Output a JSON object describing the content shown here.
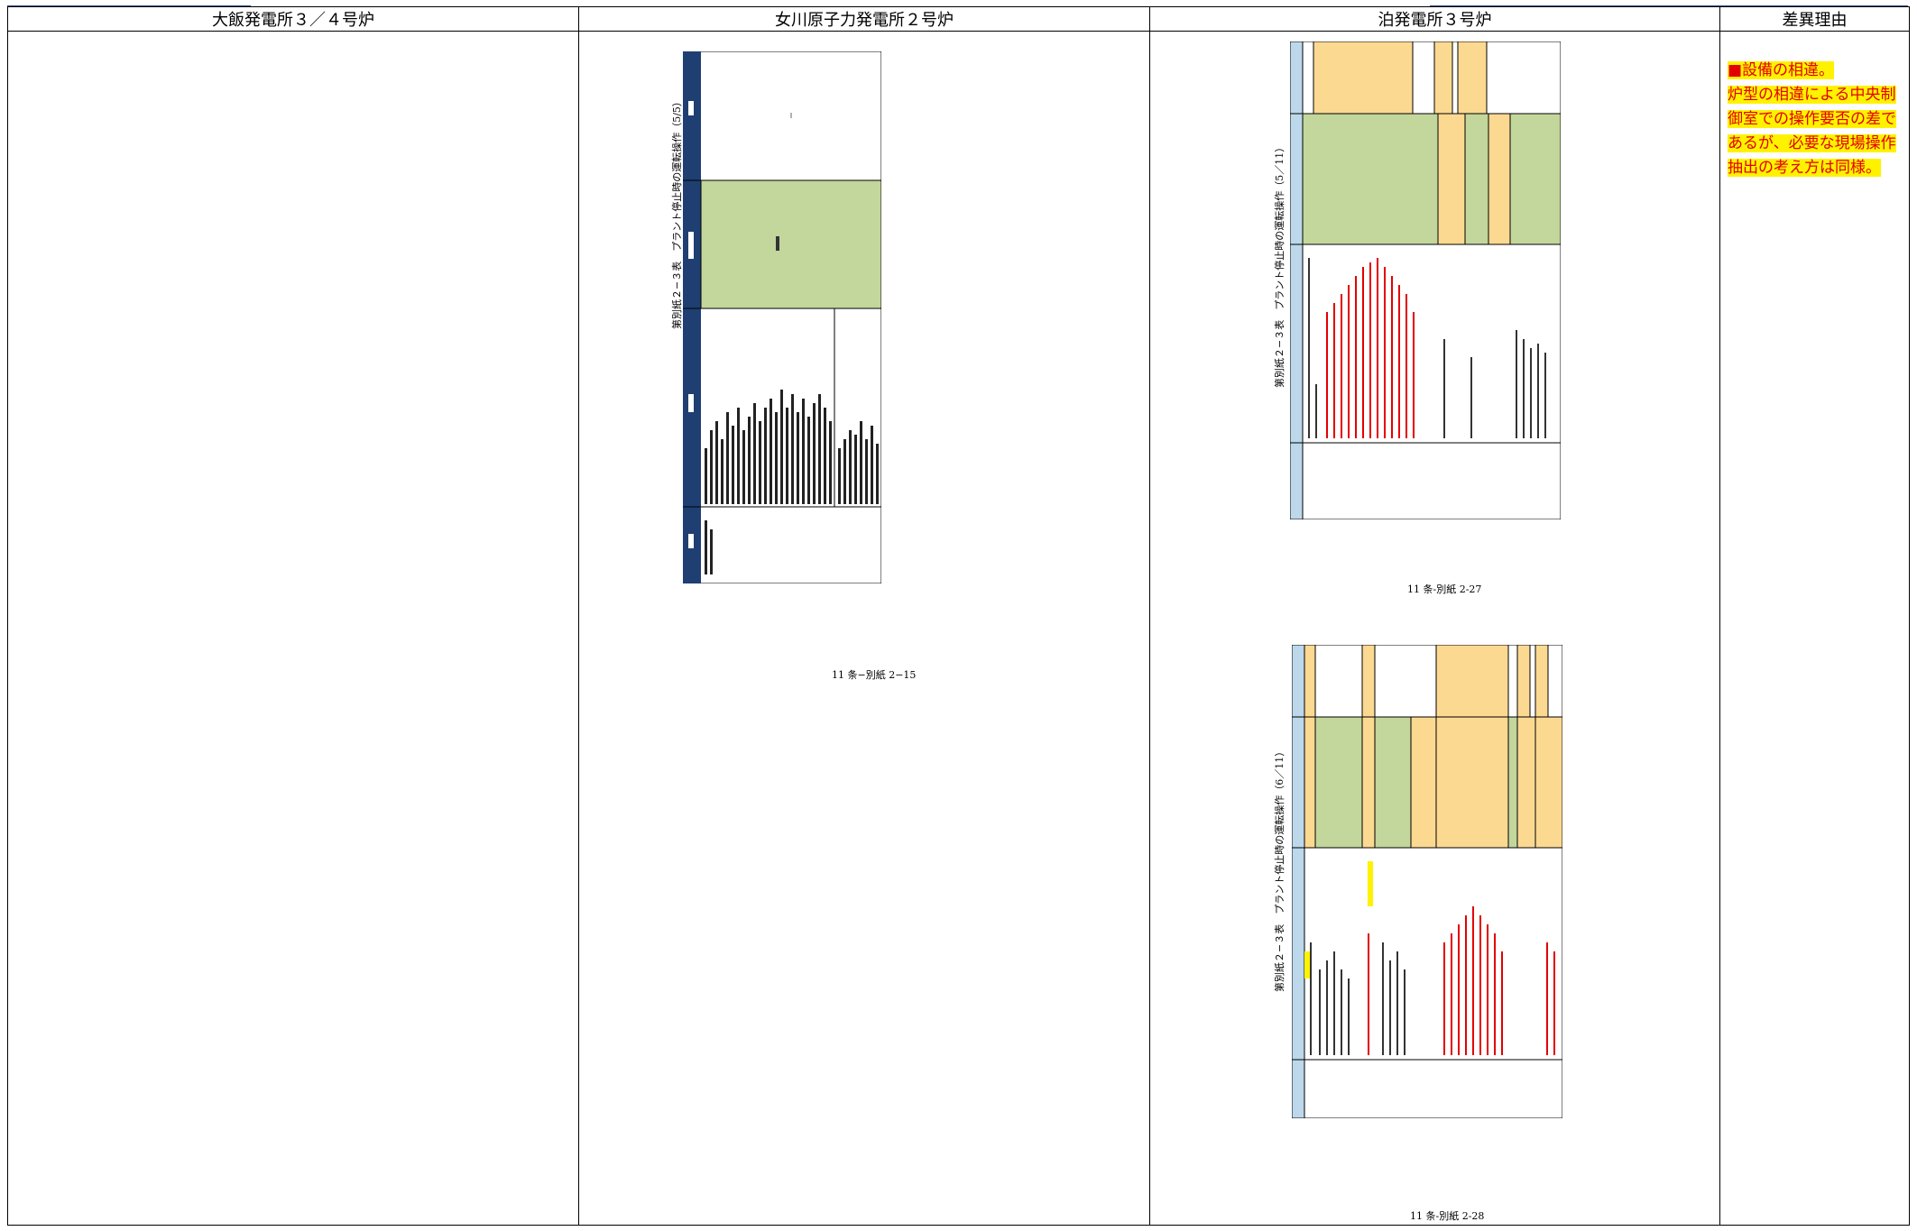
{
  "headers": {
    "col1": "大飯発電所３／４号炉",
    "col2": "女川原子力発電所２号炉",
    "col3": "泊発電所３号炉",
    "col4": "差異理由"
  },
  "onagawa": {
    "table_title": "第別紙２−３表　プラント停止時の運転操作（5/5）",
    "caption": "11 条−別紙 2−15"
  },
  "tomari": {
    "sheet1_title": "第別紙２−３表　プラント停止時の運転操作（5／11）",
    "sheet1_caption": "11 条-別紙 2-27",
    "sheet2_title": "第別紙２−３表　プラント停止時の運転操作（6／11）",
    "sheet2_caption": "11 条-別紙 2-28"
  },
  "reason": {
    "marker": "■",
    "line1": "設備の相違。",
    "line2": "炉型の相違による中央制",
    "line3": "御室での操作要否の差で",
    "line4": "あるが、必要な現場操作",
    "line5": "抽出の考え方は同様。"
  },
  "colors": {
    "header_navy": "#1f3f73",
    "header_lightblue": "#bcd8ea",
    "green_fill": "#c3d69b",
    "orange_fill": "#fbd991",
    "highlight_yellow": "#fff200",
    "text_red": "#e30000"
  }
}
